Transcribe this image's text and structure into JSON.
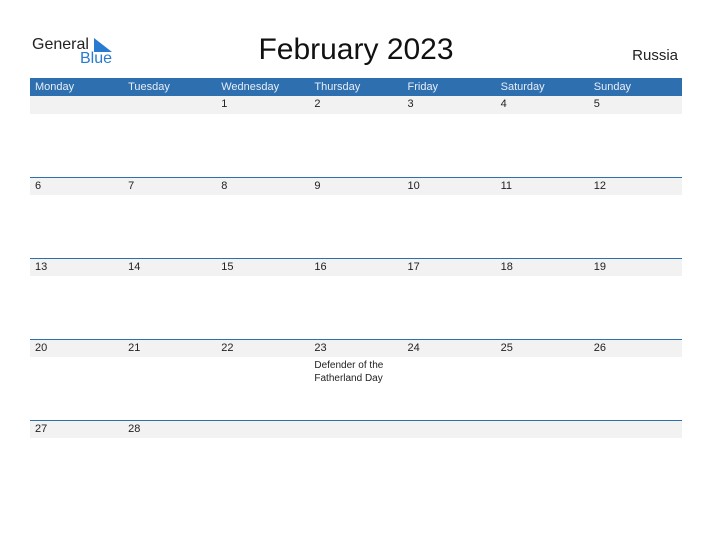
{
  "logo": {
    "word1": "General",
    "word2": "Blue",
    "icon": "blue-triangle-icon"
  },
  "title": "February 2023",
  "country": "Russia",
  "colors": {
    "header": "#2e6fb0",
    "row": "#f2f2f2",
    "logo_blue": "#2a7bd0"
  },
  "weekdays": [
    "Monday",
    "Tuesday",
    "Wednesday",
    "Thursday",
    "Friday",
    "Saturday",
    "Sunday"
  ],
  "weeks": [
    {
      "days": [
        "",
        "",
        "1",
        "2",
        "3",
        "4",
        "5"
      ],
      "notes": [
        "",
        "",
        "",
        "",
        "",
        "",
        ""
      ]
    },
    {
      "days": [
        "6",
        "7",
        "8",
        "9",
        "10",
        "11",
        "12"
      ],
      "notes": [
        "",
        "",
        "",
        "",
        "",
        "",
        ""
      ]
    },
    {
      "days": [
        "13",
        "14",
        "15",
        "16",
        "17",
        "18",
        "19"
      ],
      "notes": [
        "",
        "",
        "",
        "",
        "",
        "",
        ""
      ]
    },
    {
      "days": [
        "20",
        "21",
        "22",
        "23",
        "24",
        "25",
        "26"
      ],
      "notes": [
        "",
        "",
        "",
        "Defender of the Fatherland Day",
        "",
        "",
        ""
      ]
    },
    {
      "days": [
        "27",
        "28",
        "",
        "",
        "",
        "",
        ""
      ],
      "notes": [
        "",
        "",
        "",
        "",
        "",
        "",
        ""
      ]
    }
  ]
}
